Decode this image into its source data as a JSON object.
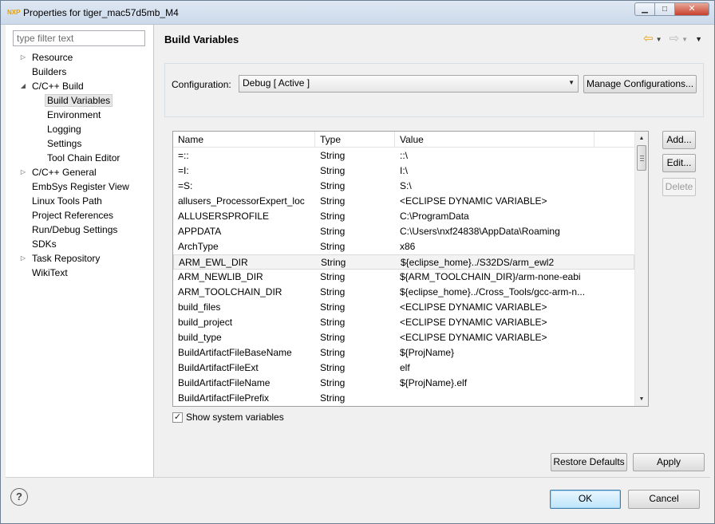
{
  "window": {
    "title": "Properties for tiger_mac57d5mb_M4",
    "app_icon": "NXP",
    "minimize": "▁",
    "maximize": "□",
    "close": "✕"
  },
  "sidebar": {
    "filter_placeholder": "type filter text",
    "items": [
      {
        "label": "Resource",
        "twisty": "▷"
      },
      {
        "label": "Builders",
        "twisty": ""
      },
      {
        "label": "C/C++ Build",
        "twisty": "◢"
      },
      {
        "label": "Build Variables",
        "twisty": ""
      },
      {
        "label": "Environment",
        "twisty": ""
      },
      {
        "label": "Logging",
        "twisty": ""
      },
      {
        "label": "Settings",
        "twisty": ""
      },
      {
        "label": "Tool Chain Editor",
        "twisty": ""
      },
      {
        "label": "C/C++ General",
        "twisty": "▷"
      },
      {
        "label": "EmbSys Register View",
        "twisty": ""
      },
      {
        "label": "Linux Tools Path",
        "twisty": ""
      },
      {
        "label": "Project References",
        "twisty": ""
      },
      {
        "label": "Run/Debug Settings",
        "twisty": ""
      },
      {
        "label": "SDKs",
        "twisty": ""
      },
      {
        "label": "Task Repository",
        "twisty": "▷"
      },
      {
        "label": "WikiText",
        "twisty": ""
      }
    ]
  },
  "page": {
    "title": "Build Variables",
    "nav_back": "⇦",
    "nav_forward": "⇨",
    "nav_caret": "▼",
    "view_menu": "▼"
  },
  "configuration": {
    "label": "Configuration:",
    "selected": "Debug  [ Active ]",
    "caret": "▼",
    "manage_button": "Manage Configurations..."
  },
  "table": {
    "columns": [
      "Name",
      "Type",
      "Value"
    ],
    "rows": [
      [
        "=::",
        "String",
        "::\\"
      ],
      [
        "=I:",
        "String",
        "I:\\"
      ],
      [
        "=S:",
        "String",
        "S:\\"
      ],
      [
        "allusers_ProcessorExpert_loc",
        "String",
        "<ECLIPSE DYNAMIC VARIABLE>"
      ],
      [
        "ALLUSERSPROFILE",
        "String",
        "C:\\ProgramData"
      ],
      [
        "APPDATA",
        "String",
        "C:\\Users\\nxf24838\\AppData\\Roaming"
      ],
      [
        "ArchType",
        "String",
        "x86"
      ],
      [
        "ARM_EWL_DIR",
        "String",
        "${eclipse_home}../S32DS/arm_ewl2"
      ],
      [
        "ARM_NEWLIB_DIR",
        "String",
        "${ARM_TOOLCHAIN_DIR}/arm-none-eabi"
      ],
      [
        "ARM_TOOLCHAIN_DIR",
        "String",
        "${eclipse_home}../Cross_Tools/gcc-arm-n..."
      ],
      [
        "build_files",
        "String",
        "<ECLIPSE DYNAMIC VARIABLE>"
      ],
      [
        "build_project",
        "String",
        "<ECLIPSE DYNAMIC VARIABLE>"
      ],
      [
        "build_type",
        "String",
        "<ECLIPSE DYNAMIC VARIABLE>"
      ],
      [
        "BuildArtifactFileBaseName",
        "String",
        "${ProjName}"
      ],
      [
        "BuildArtifactFileExt",
        "String",
        "elf"
      ],
      [
        "BuildArtifactFileName",
        "String",
        "${ProjName}.elf"
      ],
      [
        "BuildArtifactFilePrefix",
        "String",
        ""
      ]
    ],
    "scroll_up": "▲",
    "scroll_down": "▼"
  },
  "side_buttons": {
    "add": "Add...",
    "edit": "Edit...",
    "delete": "Delete"
  },
  "show_system": {
    "label": "Show system variables",
    "checked": true,
    "check_glyph": "✓"
  },
  "footer": {
    "restore_defaults": "Restore Defaults",
    "apply": "Apply",
    "ok": "OK",
    "cancel": "Cancel",
    "help_glyph": "?"
  }
}
